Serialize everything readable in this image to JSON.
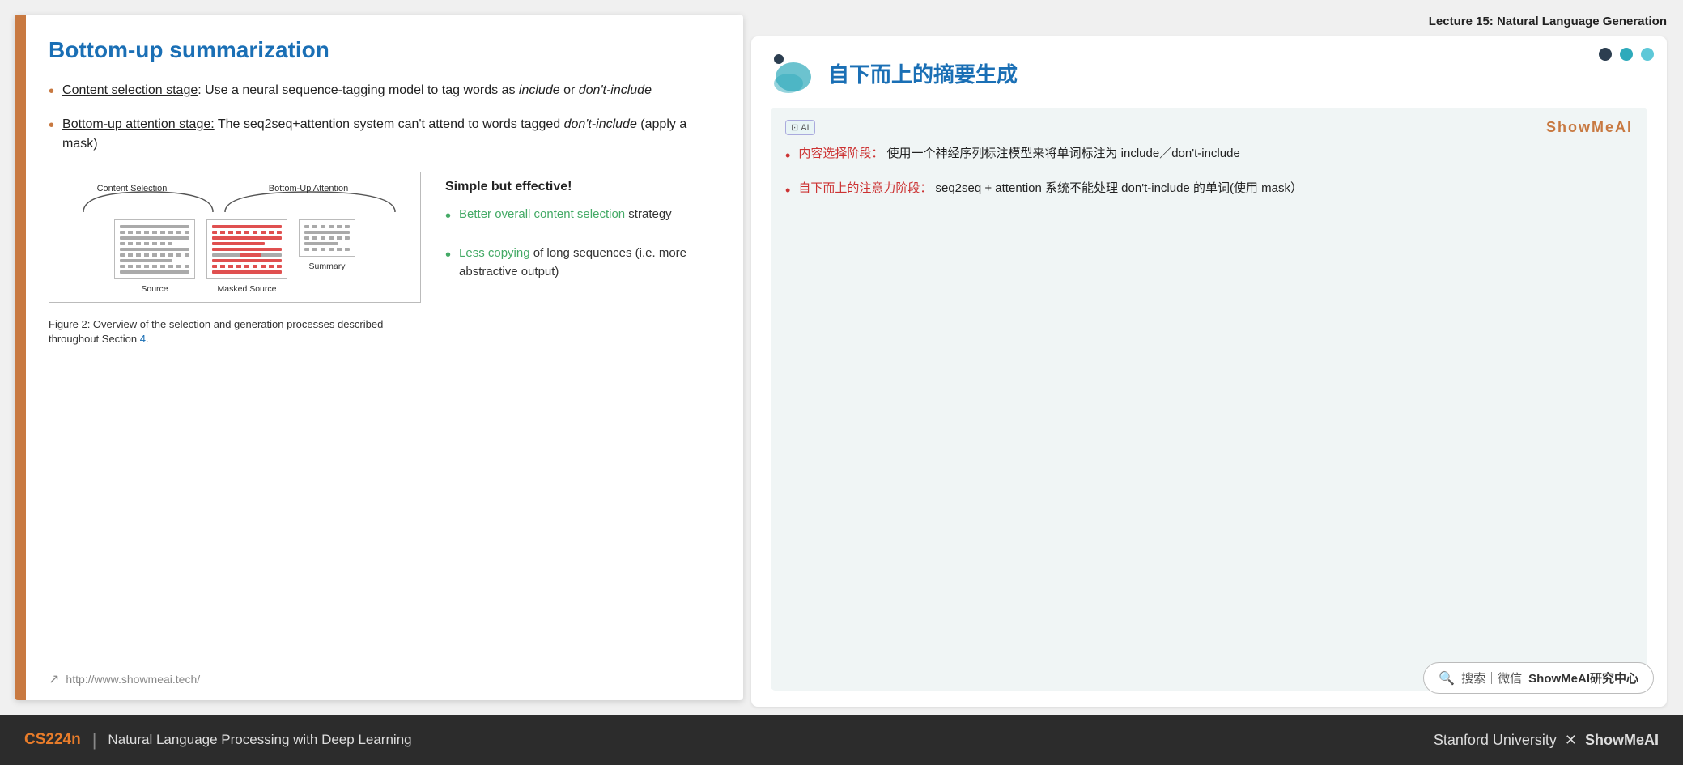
{
  "lecture": {
    "header": "Lecture 15: Natural Language Generation"
  },
  "slide": {
    "title": "Bottom-up summarization",
    "bullets": [
      {
        "label_underline": "Content selection stage",
        "text": ": Use a neural sequence-tagging model to tag words as ",
        "italic1": "include",
        "text2": " or ",
        "italic2": "don't-include"
      },
      {
        "label_underline": "Bottom-up attention stage",
        "text": ": The seq2seq+attention system can't attend to words tagged ",
        "italic1": "don't-include",
        "text2": " (apply a mask)"
      }
    ],
    "figure": {
      "col1": "Content Selection",
      "col2": "Bottom-Up Attention",
      "label1": "Source",
      "label2": "Masked Source",
      "label3": "Summary",
      "caption": "Figure 2: Overview of the selection and generation processes described throughout Section 4."
    },
    "simple_effective": {
      "title": "Simple but effective!",
      "bullets": [
        {
          "green": "Better overall content selection",
          "rest": " strategy"
        },
        {
          "green": "Less copying",
          "rest": " of long sequences (i.e. more abstractive output)"
        }
      ]
    },
    "footer_link": "http://www.showmeai.tech/"
  },
  "right_card": {
    "title": "自下而上的摘要生成",
    "showmeai_brand": "ShowMeAI",
    "ai_badge": "AI",
    "bullets": [
      {
        "label": "内容选择阶段：",
        "text": " 使用一个神经序列标注模型来将单词标注为 include／don't-include"
      },
      {
        "label": "自下而上的注意力阶段：",
        "text": " seq2seq + attention 系统不能处理 don't-include 的单词(使用 mask）"
      }
    ],
    "dots": [
      "dark",
      "teal",
      "teal-light"
    ],
    "search_text": "搜索｜微信 ShowMeAI研究中心"
  },
  "bottom_bar": {
    "course": "CS224n",
    "divider": "|",
    "description": "Natural Language Processing with Deep Learning",
    "right": "Stanford University X ShowMeAI"
  }
}
